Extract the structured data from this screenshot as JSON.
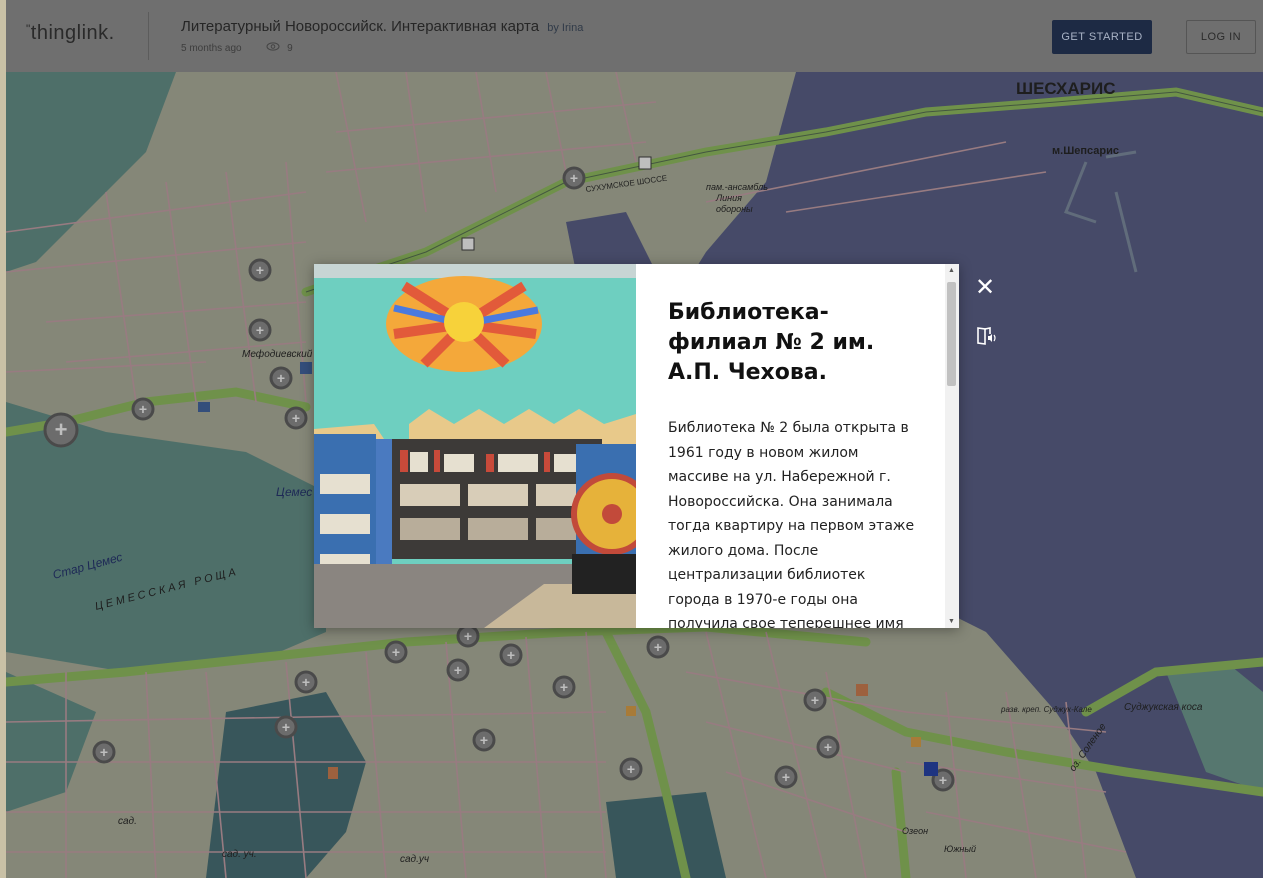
{
  "header": {
    "logo": "thinglink.",
    "title": "Литературный Новороссийск. Интерактивная карта",
    "by": "by Irina",
    "age": "5 months ago",
    "views": "9",
    "get_started": "GET STARTED",
    "login": "LOG IN"
  },
  "map": {
    "labels": {
      "sheskharis": "ШЕСХАРИС",
      "shepsarius": "м.Шепсарис",
      "memorial": "пам.-ансамбль",
      "memorial2": "Линия",
      "memorial3": "обороны",
      "mefodievsky": "Мефодиевский",
      "tsemes": "Цемес",
      "star_tsemes": "Стар Цемес",
      "grove": "ЦЕМЕССКАЯ РОЩА",
      "sukhum": "СУХУМСКОЕ ШОССЕ",
      "sudzhuk": "Суджукская коса",
      "solenoe": "оз. Соленое",
      "ruins": "разв. креп. Суджук-Кале",
      "ozhon": "Озеон",
      "yuzhny": "Южный",
      "sad1": "сад.",
      "sad2": "сад. уч.",
      "sad3": "сад.уч"
    }
  },
  "popup": {
    "title": "Библиотека-филиал № 2 им. А.П. Чехова.",
    "body": "Библиотека № 2 была открыта в 1961 году в новом жилом массиве на ул. Набережной г. Новороссийска. Она занимала тогда квартиру на первом этаже жилого дома. После централизации библиотек города в 1970-е годы она получила свое теперешнее имя",
    "close_icon": "close-icon",
    "reader_icon": "immersive-reader-icon"
  },
  "colors": {
    "water": "#535a84",
    "land": "#aeb19b",
    "road": "#8fbf5a",
    "street": "#c9a0a8",
    "header_bg": "#6f6f6f",
    "button_bg": "#1d2a44"
  }
}
